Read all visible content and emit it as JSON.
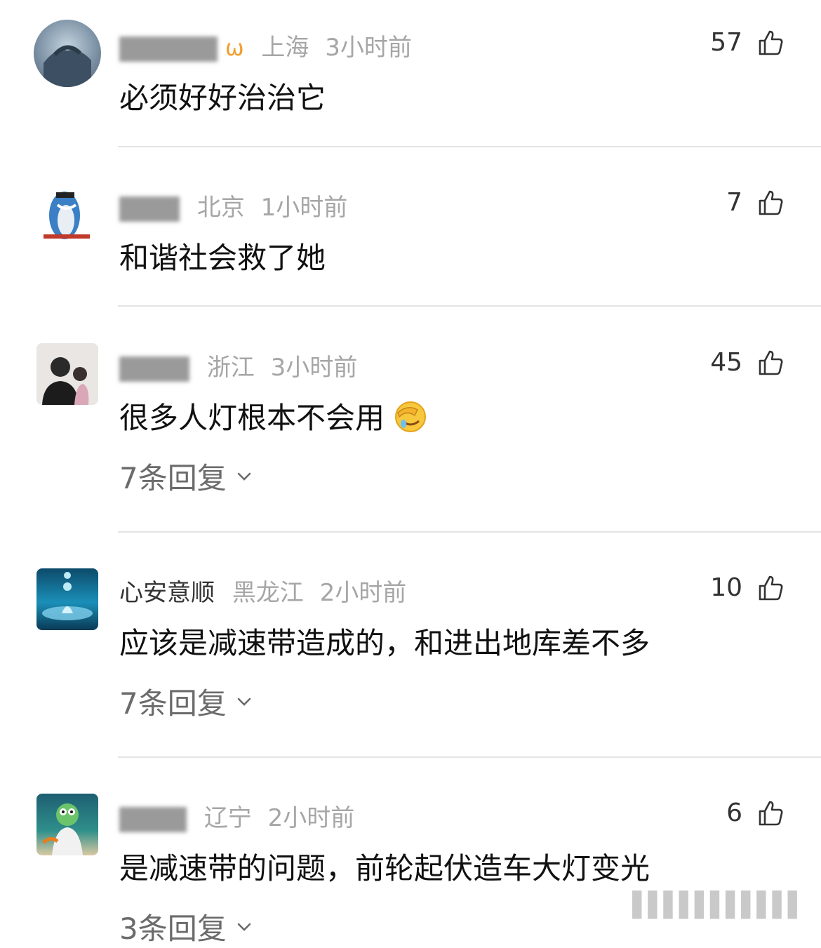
{
  "comments": [
    {
      "user": "",
      "location": "上海",
      "time": "3小时前",
      "likes": "57",
      "text": "必须好好治治它",
      "replies": ""
    },
    {
      "user": "",
      "location": "北京",
      "time": "1小时前",
      "likes": "7",
      "text": "和谐社会救了她",
      "replies": ""
    },
    {
      "user": "",
      "location": "浙江",
      "time": "3小时前",
      "likes": "45",
      "text": "很多人灯根本不会用",
      "replies": "7条回复"
    },
    {
      "user": "心安意顺",
      "location": "黑龙江",
      "time": "2小时前",
      "likes": "10",
      "text": "应该是减速带造成的，和进出地库差不多",
      "replies": "7条回复"
    },
    {
      "user": "",
      "location": "辽宁",
      "time": "2小时前",
      "likes": "6",
      "text": "是减速带的问题，前轮起伏造车大灯变光",
      "replies": "3条回复"
    }
  ],
  "icons": {
    "like": "thumbs-up-outline-icon",
    "expand": "chevron-down-icon",
    "emoji": "facepalm-laughing-emoji"
  },
  "colors": {
    "meta_gray": "#a6a6a6",
    "text": "#111111",
    "divider": "#e4e4e4"
  }
}
